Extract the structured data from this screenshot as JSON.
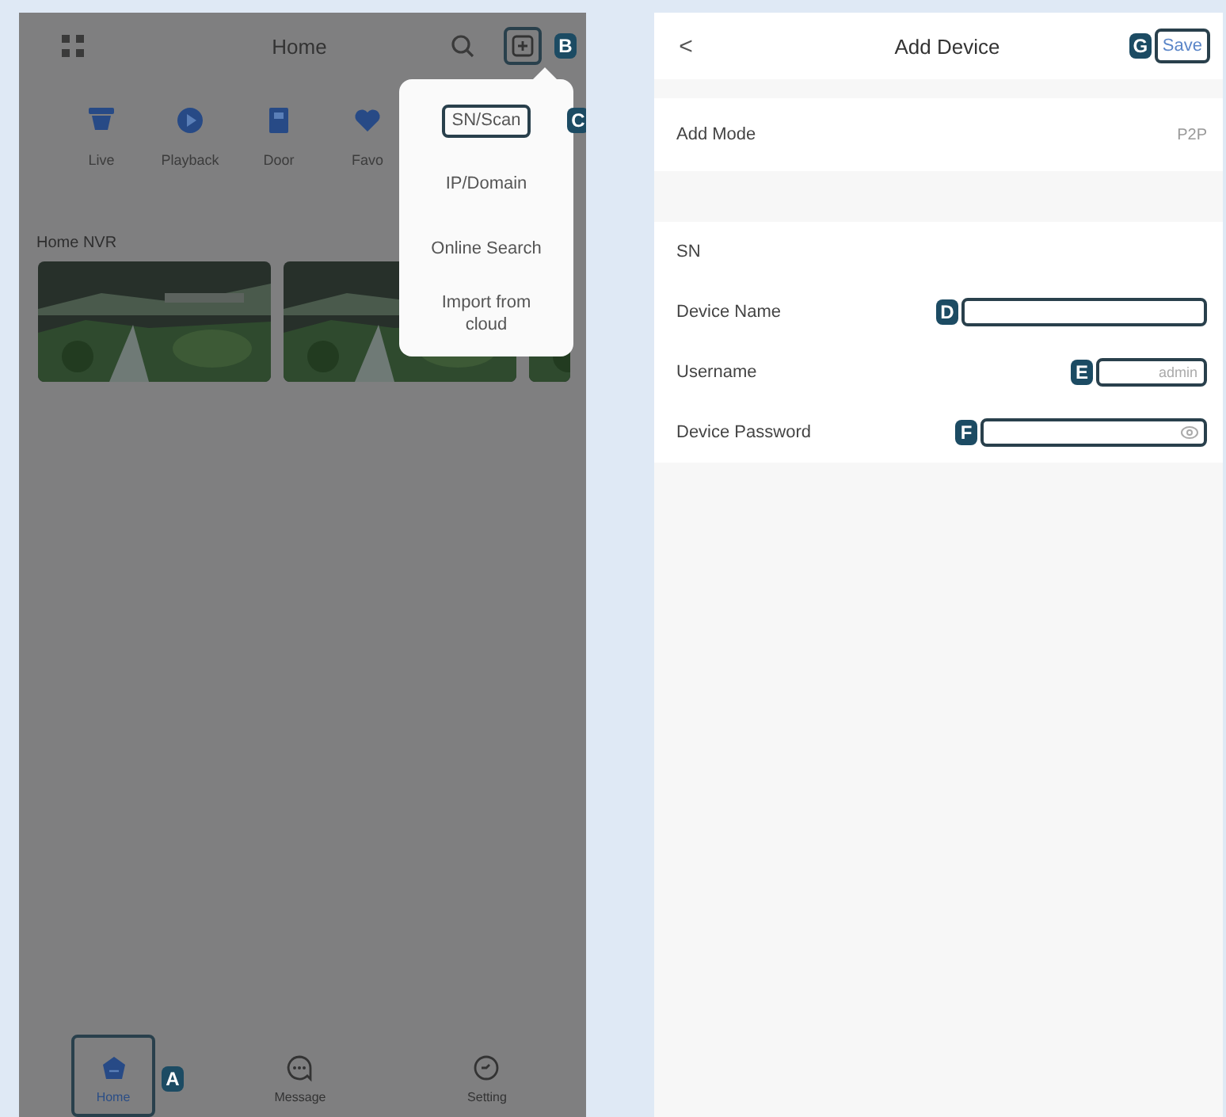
{
  "home_screen": {
    "title": "Home",
    "quick_actions": [
      {
        "label": "Live",
        "kind": "camera"
      },
      {
        "label": "Playback",
        "kind": "playback"
      },
      {
        "label": "Door",
        "kind": "door"
      },
      {
        "label": "Favo",
        "kind": "favorite"
      }
    ],
    "section_title": "Home NVR",
    "add_button": {
      "callout": "B"
    },
    "add_menu": [
      {
        "label": "SN/Scan",
        "callout": "C"
      },
      {
        "label": "IP/Domain"
      },
      {
        "label": "Online Search"
      },
      {
        "label": "Import from cloud"
      }
    ],
    "tab_bar": [
      {
        "label": "Home",
        "kind": "home",
        "selected": true,
        "callout": "A"
      },
      {
        "label": "Message",
        "kind": "message",
        "selected": false
      },
      {
        "label": "Setting",
        "kind": "setting",
        "selected": false
      }
    ]
  },
  "add_device_screen": {
    "title": "Add Device",
    "back": "<",
    "save": {
      "label": "Save",
      "callout": "G"
    },
    "mode_row": {
      "label": "Add Mode",
      "value": "P2P"
    },
    "sn_row": {
      "label": "SN"
    },
    "fields": [
      {
        "label": "Device Name",
        "kind": "text",
        "callout": "D"
      },
      {
        "label": "Username",
        "kind": "text",
        "value": "admin",
        "callout": "E"
      },
      {
        "label": "Device Password",
        "kind": "password",
        "callout": "F"
      }
    ]
  }
}
